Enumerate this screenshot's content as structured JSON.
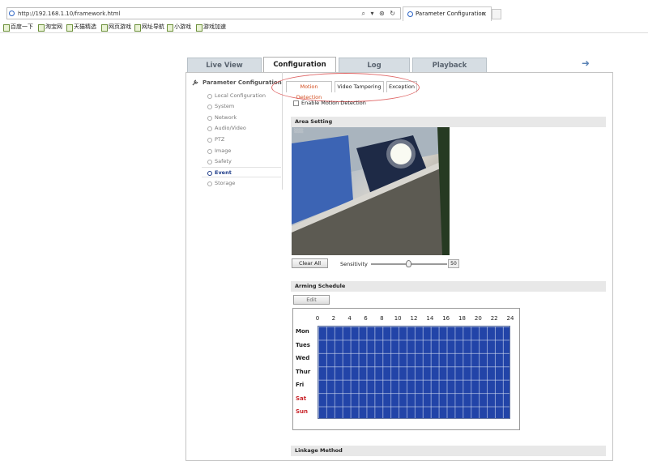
{
  "browser": {
    "url": "http://192.168.1.10/framework.html",
    "address_tools": "⌕ ▾ ⊛ ↻",
    "tab_title": "Parameter Configuration",
    "tab_close": "✕",
    "favorites": [
      "百度一下",
      "淘宝网",
      "天猫精选",
      "网页游戏",
      "网址导航",
      "小游戏",
      "游戏加速"
    ]
  },
  "main_tabs": [
    "Live View",
    "Configuration",
    "Log",
    "Playback"
  ],
  "sidebar": {
    "header": "Parameter Configuration",
    "items": [
      "Local Configuration",
      "System",
      "Network",
      "Audio/Video",
      "PTZ",
      "Image",
      "Safety",
      "Event",
      "Storage"
    ]
  },
  "sub_tabs": [
    "Motion Detection",
    "Video Tampering",
    "Exception"
  ],
  "enable_label": "Enable Motion Detection",
  "area_setting": {
    "title": "Area Setting",
    "clear_all": "Clear All",
    "sensitivity_label": "Sensitivity",
    "sensitivity_value": "50",
    "sensitivity_level": 0.5
  },
  "arming_schedule": {
    "title": "Arming Schedule",
    "edit": "Edit",
    "hours": [
      "0",
      "2",
      "4",
      "6",
      "8",
      "10",
      "12",
      "14",
      "16",
      "18",
      "20",
      "22",
      "24"
    ],
    "days": [
      "Mon",
      "Tues",
      "Wed",
      "Thur",
      "Fri",
      "Sat",
      "Sun"
    ]
  },
  "linkage_title": "Linkage Method",
  "colors": {
    "accent": "#d24a1b",
    "grid": "#2244a8",
    "weekend": "#c9262c"
  }
}
